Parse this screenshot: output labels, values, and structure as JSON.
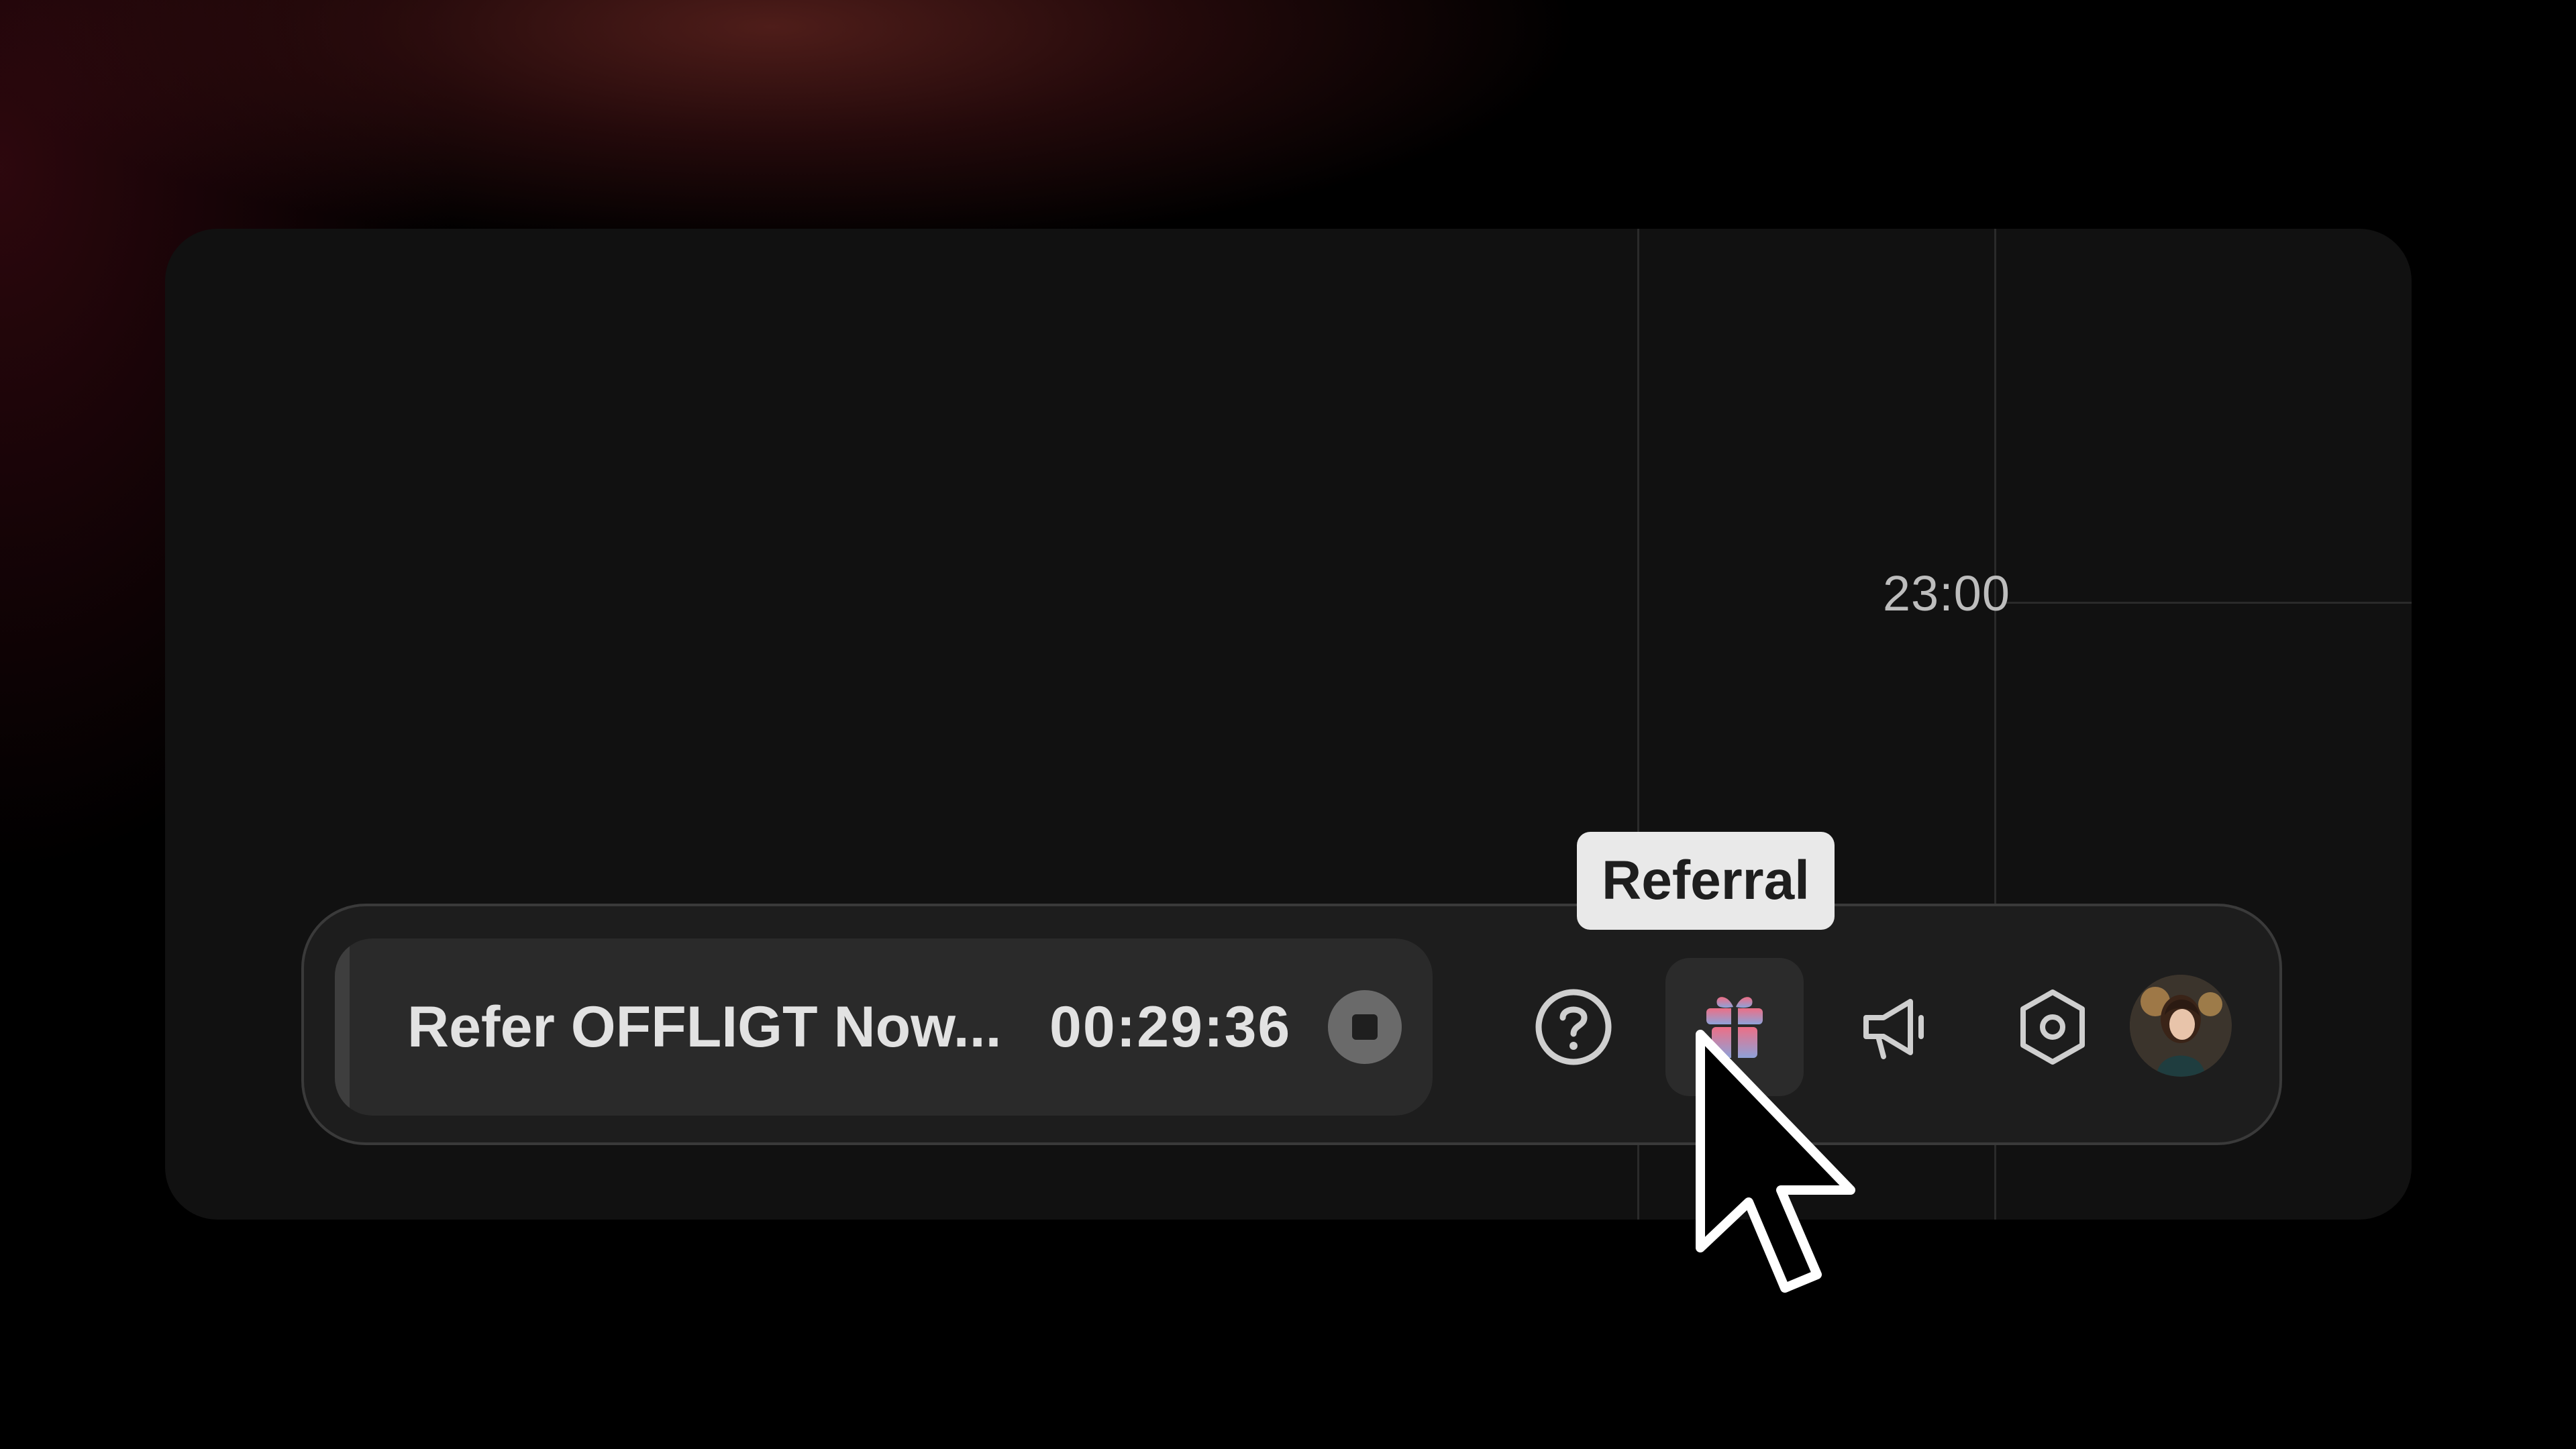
{
  "calendar": {
    "time_label": "23:00"
  },
  "timer": {
    "title": "Refer OFFLIGT Now...",
    "elapsed": "00:29:36",
    "stop_icon": "stop-icon"
  },
  "toolbar": {
    "items": [
      {
        "icon": "help-circle-icon"
      },
      {
        "icon": "gift-icon",
        "active": true
      },
      {
        "icon": "megaphone-icon"
      },
      {
        "icon": "settings-hexagon-icon"
      },
      {
        "icon": "user-avatar"
      }
    ]
  },
  "tooltip": {
    "label": "Referral"
  },
  "colors": {
    "background": "#000000",
    "window": "#111111",
    "dock": "#1d1d1d",
    "tooltip_bg": "#e9e9e9",
    "gift_pink": "#e57a93",
    "gift_blue": "#8aa0d8"
  }
}
